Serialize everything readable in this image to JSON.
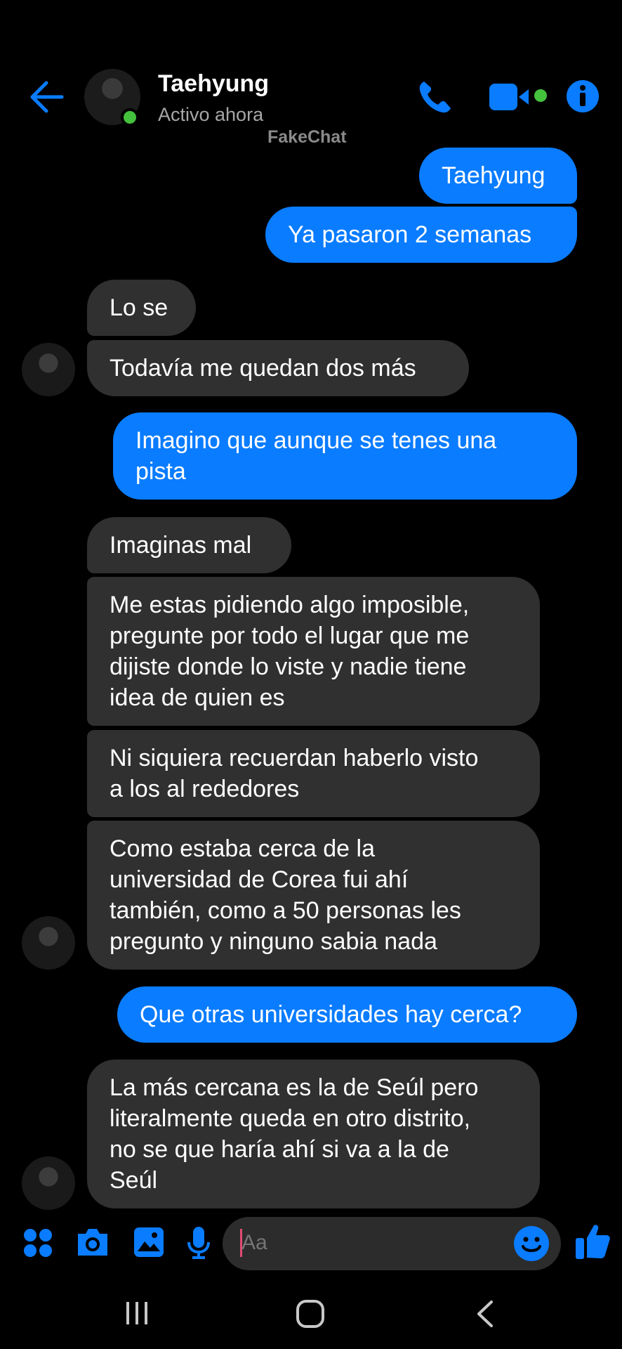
{
  "header": {
    "contact_name": "Taehyung",
    "status": "Activo ahora",
    "watermark": "FakeChat"
  },
  "messages": [
    {
      "from": "me",
      "text": "Taehyung"
    },
    {
      "from": "me",
      "text": "Ya pasaron 2 semanas"
    },
    {
      "from": "them",
      "text": "Lo se"
    },
    {
      "from": "them",
      "text": "Todavía me quedan dos más"
    },
    {
      "from": "me",
      "text": "Imagino que aunque se tenes una\npista"
    },
    {
      "from": "them",
      "text": "Imaginas mal"
    },
    {
      "from": "them",
      "text": "Me estas pidiendo algo imposible,\npregunte por todo el lugar que me\ndijiste donde lo viste y nadie tiene\nidea de quien es"
    },
    {
      "from": "them",
      "text": "Ni siquiera recuerdan haberlo visto\na los al rededores"
    },
    {
      "from": "them",
      "text": "Como estaba cerca de la\nuniversidad de Corea fui ahí\ntambién, como a 50 personas les\npregunto y ninguno sabia nada"
    },
    {
      "from": "me",
      "text": "Que otras universidades hay cerca?"
    },
    {
      "from": "them",
      "text": "La más cercana es la de Seúl pero\nliteralmente queda en otro distrito,\nno se que haría ahí si va a la de\nSeúl"
    }
  ],
  "composer": {
    "placeholder": "Aa"
  },
  "colors": {
    "accent": "#0a7cff",
    "received_bubble": "#303030",
    "online": "#44c23d"
  }
}
